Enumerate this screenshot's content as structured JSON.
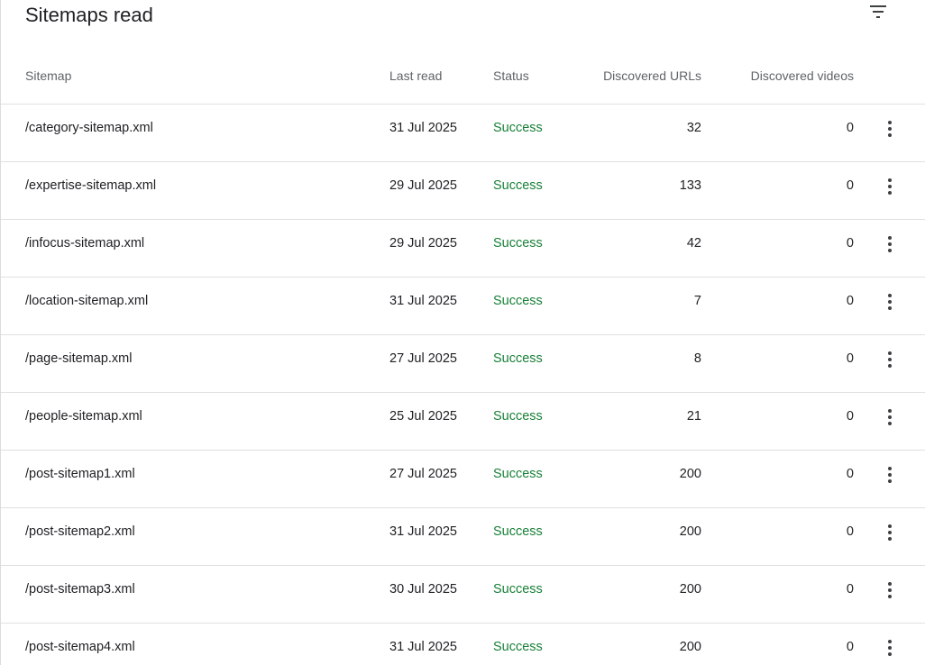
{
  "card": {
    "title": "Sitemaps read",
    "filter_icon": "filter-list-icon"
  },
  "columns": {
    "sitemap": "Sitemap",
    "last_read": "Last read",
    "status": "Status",
    "discovered_urls": "Discovered URLs",
    "discovered_videos": "Discovered videos"
  },
  "colors": {
    "status_success": "#188038",
    "header_text": "#5f6368",
    "body_text": "#202124",
    "divider": "#e0e0e0"
  },
  "rows": [
    {
      "sitemap": "/category-sitemap.xml",
      "last_read": "31 Jul 2025",
      "status": "Success",
      "urls": "32",
      "videos": "0",
      "menu_icon": "more-vert-icon"
    },
    {
      "sitemap": "/expertise-sitemap.xml",
      "last_read": "29 Jul 2025",
      "status": "Success",
      "urls": "133",
      "videos": "0",
      "menu_icon": "more-vert-icon"
    },
    {
      "sitemap": "/infocus-sitemap.xml",
      "last_read": "29 Jul 2025",
      "status": "Success",
      "urls": "42",
      "videos": "0",
      "menu_icon": "more-vert-icon"
    },
    {
      "sitemap": "/location-sitemap.xml",
      "last_read": "31 Jul 2025",
      "status": "Success",
      "urls": "7",
      "videos": "0",
      "menu_icon": "more-vert-icon"
    },
    {
      "sitemap": "/page-sitemap.xml",
      "last_read": "27 Jul 2025",
      "status": "Success",
      "urls": "8",
      "videos": "0",
      "menu_icon": "more-vert-icon"
    },
    {
      "sitemap": "/people-sitemap.xml",
      "last_read": "25 Jul 2025",
      "status": "Success",
      "urls": "21",
      "videos": "0",
      "menu_icon": "more-vert-icon"
    },
    {
      "sitemap": "/post-sitemap1.xml",
      "last_read": "27 Jul 2025",
      "status": "Success",
      "urls": "200",
      "videos": "0",
      "menu_icon": "more-vert-icon"
    },
    {
      "sitemap": "/post-sitemap2.xml",
      "last_read": "31 Jul 2025",
      "status": "Success",
      "urls": "200",
      "videos": "0",
      "menu_icon": "more-vert-icon"
    },
    {
      "sitemap": "/post-sitemap3.xml",
      "last_read": "30 Jul 2025",
      "status": "Success",
      "urls": "200",
      "videos": "0",
      "menu_icon": "more-vert-icon"
    },
    {
      "sitemap": "/post-sitemap4.xml",
      "last_read": "31 Jul 2025",
      "status": "Success",
      "urls": "200",
      "videos": "0",
      "menu_icon": "more-vert-icon"
    }
  ]
}
